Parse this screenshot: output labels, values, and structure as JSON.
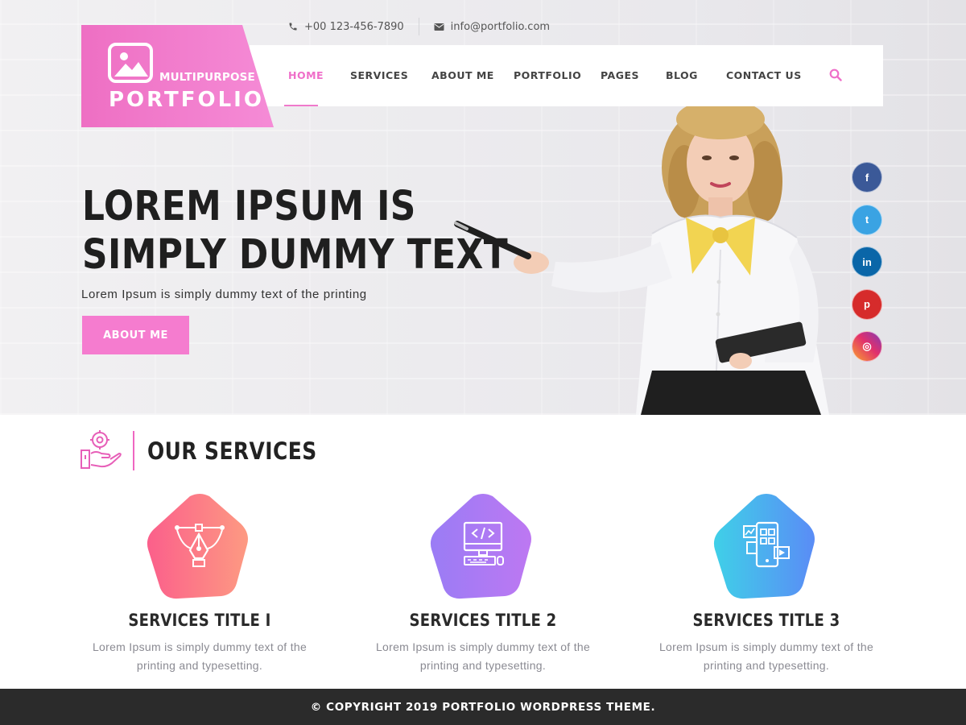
{
  "header": {
    "phone": "+00 123-456-7890",
    "email": "info@portfolio.com",
    "phone_icon": "phone-icon",
    "email_icon": "envelope-icon"
  },
  "logo": {
    "line1": "MULTIPURPOSE",
    "line2": "PORTFOLIO",
    "icon": "image-icon"
  },
  "nav": {
    "items": [
      {
        "label": "HOME",
        "active": true
      },
      {
        "label": "SERVICES"
      },
      {
        "label": "ABOUT ME"
      },
      {
        "label": "PORTFOLIO"
      },
      {
        "label": "PAGES"
      },
      {
        "label": "BLOG"
      },
      {
        "label": "CONTACT US"
      }
    ],
    "search_icon": "search-icon"
  },
  "hero": {
    "headline_line1": "LOREM IPSUM IS",
    "headline_line2": "SIMPLY DUMMY TEXT",
    "subtitle": "Lorem Ipsum is simply dummy text of the printing",
    "button_label": "ABOUT ME"
  },
  "social": [
    {
      "name": "facebook-icon",
      "glyph": "f",
      "color": "#3b5998"
    },
    {
      "name": "twitter-icon",
      "glyph": "t",
      "color": "#3aa3e3"
    },
    {
      "name": "linkedin-icon",
      "glyph": "in",
      "color": "#0a66a8"
    },
    {
      "name": "pinterest-icon",
      "glyph": "p",
      "color": "#d62b2b"
    },
    {
      "name": "instagram-icon",
      "glyph": "◎",
      "color": "#d6287a"
    }
  ],
  "services": {
    "title": "OUR SERVICES",
    "items": [
      {
        "title": "SERVICES TITLE I",
        "desc": "Lorem Ipsum is simply dummy text of the printing and typesetting.",
        "icon": "pen-tool-icon"
      },
      {
        "title": "SERVICES TITLE 2",
        "desc": "Lorem Ipsum is simply dummy text of the printing and typesetting.",
        "icon": "computer-code-icon"
      },
      {
        "title": "SERVICES TITLE 3",
        "desc": "Lorem Ipsum is simply dummy text of the printing and typesetting.",
        "icon": "app-design-icon"
      }
    ]
  },
  "footer": {
    "copyright": "© COPYRIGHT 2019 PORTFOLIO WORDPRESS THEME."
  },
  "colors": {
    "accent": "#f57ccf",
    "dark": "#2b2b2b"
  }
}
